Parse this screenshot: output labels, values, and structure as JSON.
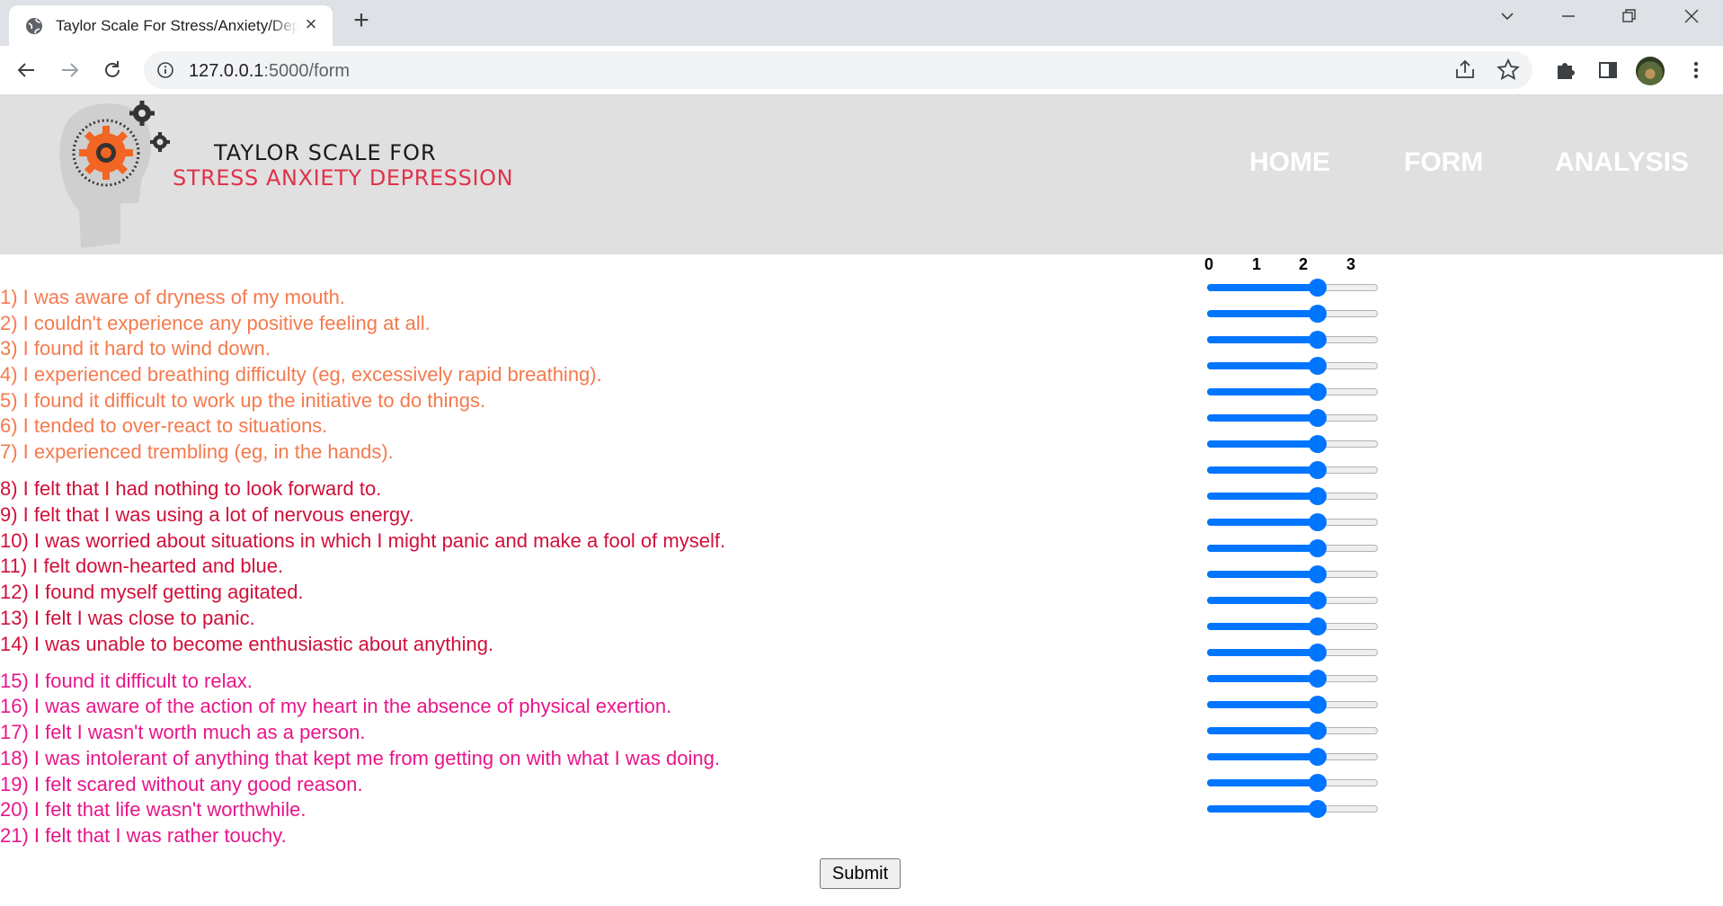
{
  "browser": {
    "tab_title": "Taylor Scale For Stress/Anxiety/Depression",
    "url_host": "127.0.0.1",
    "url_path": ":5000/form"
  },
  "site": {
    "brand_line1": "TAYLOR SCALE FOR",
    "brand_line2": "STRESS ANXIETY DEPRESSION",
    "nav": [
      "HOME",
      "FORM",
      "ANALYSIS"
    ]
  },
  "form": {
    "scale_labels": [
      "0",
      "1",
      "2",
      "3"
    ],
    "questions": [
      {
        "text": "1) I was aware of dryness of my mouth.",
        "value": 2
      },
      {
        "text": "2) I couldn't experience any positive feeling at all.",
        "value": 2
      },
      {
        "text": "3) I found it hard to wind down.",
        "value": 2
      },
      {
        "text": "4) I experienced breathing difficulty (eg, excessively rapid breathing).",
        "value": 2
      },
      {
        "text": "5) I found it difficult to work up the initiative to do things.",
        "value": 2
      },
      {
        "text": "6) I tended to over-react to situations.",
        "value": 2
      },
      {
        "text": "7) I experienced trembling (eg, in the hands).",
        "value": 2
      },
      {
        "text": "8) I felt that I had nothing to look forward to.",
        "value": 2
      },
      {
        "text": "9) I felt that I was using a lot of nervous energy.",
        "value": 2
      },
      {
        "text": "10) I was worried about situations in which I might panic and make a fool of myself.",
        "value": 2
      },
      {
        "text": "11) I felt down-hearted and blue.",
        "value": 2
      },
      {
        "text": "12) I found myself getting agitated.",
        "value": 2
      },
      {
        "text": "13) I felt I was close to panic.",
        "value": 2
      },
      {
        "text": "14) I was unable to become enthusiastic about anything.",
        "value": 2
      },
      {
        "text": "15) I found it difficult to relax.",
        "value": 2
      },
      {
        "text": "16) I was aware of the action of my heart in the absence of physical exertion.",
        "value": 2
      },
      {
        "text": "17) I felt I wasn't worth much as a person.",
        "value": 2
      },
      {
        "text": "18) I was intolerant of anything that kept me from getting on with what I was doing.",
        "value": 2
      },
      {
        "text": "19) I felt scared without any good reason.",
        "value": 2
      },
      {
        "text": "20) I felt that life wasn't worthwhile.",
        "value": 2
      },
      {
        "text": "21) I felt that I was rather touchy.",
        "value": 2
      }
    ],
    "slider_max": 3,
    "submit_label": "Submit"
  },
  "colors": {
    "group1": "#f47a4d",
    "group2": "#d0103a",
    "group3": "#e8168a",
    "slider": "#0075ff",
    "header_bg": "#e0e0e0"
  }
}
